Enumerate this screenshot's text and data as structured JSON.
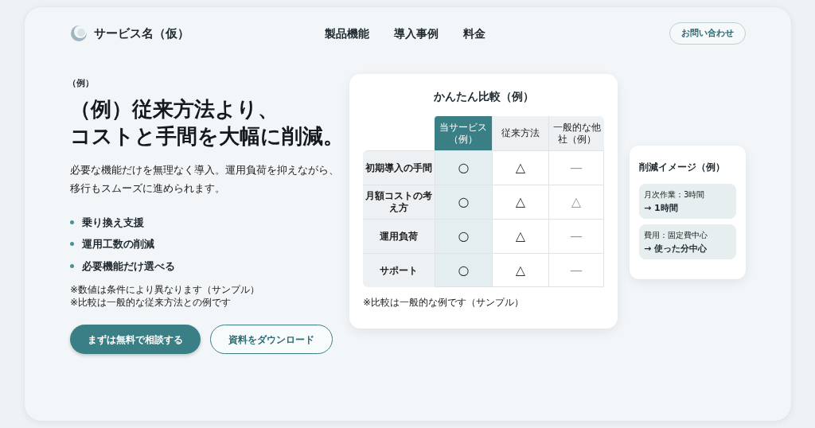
{
  "header": {
    "logo_text": "サービス名（仮）",
    "nav": [
      "製品機能",
      "導入事例",
      "料金"
    ],
    "contact_button": "お問い合わせ"
  },
  "hero": {
    "eyebrow": "（例）",
    "headline": [
      "（例）従来方法より、",
      "コストと手間を大幅に削減。"
    ],
    "description": [
      "必要な機能だけを無理なく導入。運用負荷を抑えながら、",
      "移行もスムーズに進められます。"
    ],
    "bullets": [
      "乗り換え支援",
      "運用工数の削減",
      "必要機能だけ選べる"
    ],
    "notes": [
      "※数値は条件により異なります（サンプル）",
      "※比較は一般的な従来方法との例です"
    ],
    "primary_button": "まずは無料で相談する",
    "secondary_button": "資料をダウンロード"
  },
  "comparison": {
    "title": "かんたん比較（例）",
    "columns": [
      {
        "label": "当サービス（例）",
        "highlighted": true
      },
      {
        "label": "従来方法",
        "highlighted": false
      },
      {
        "label": "一般的な他社（例）",
        "highlighted": false
      }
    ],
    "rows": [
      {
        "label": "初期導入の手間",
        "cells": [
          "○",
          "△",
          "—"
        ]
      },
      {
        "label": "月額コストの考え方",
        "cells": [
          "○",
          "△",
          "△"
        ]
      },
      {
        "label": "運用負荷",
        "cells": [
          "○",
          "△",
          "—"
        ]
      },
      {
        "label": "サポート",
        "cells": [
          "○",
          "△",
          "—"
        ]
      }
    ],
    "footnote": "※比較は一般的な例です（サンプル）"
  },
  "reduction": {
    "title": "削減イメージ（例）",
    "items": [
      {
        "from": "月次作業：3時間",
        "to": "→ 1時間"
      },
      {
        "from": "費用：固定費中心",
        "to": "→ 使った分中心"
      }
    ]
  }
}
